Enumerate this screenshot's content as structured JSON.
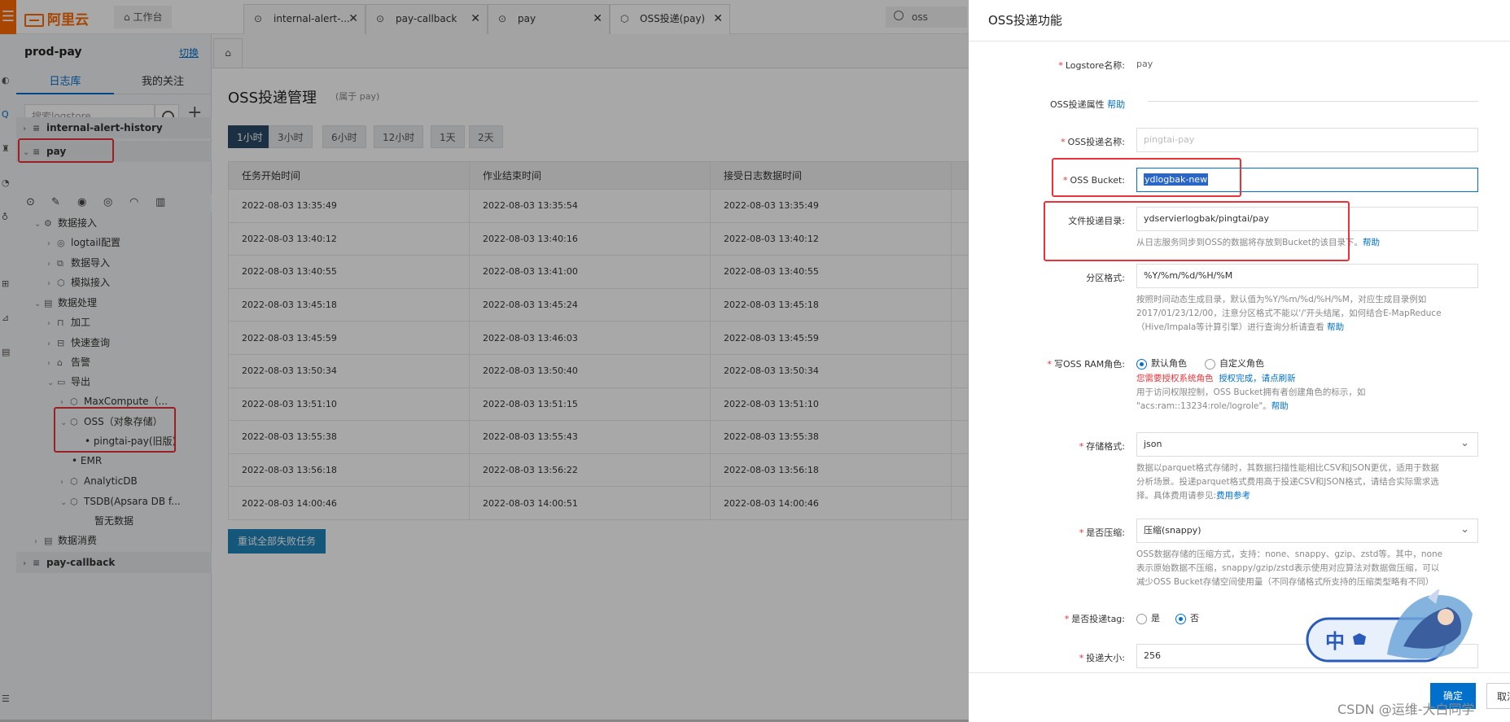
{
  "topbar": {
    "menu_icon": "menu-icon",
    "brand": "阿里云",
    "workbench": "工作台",
    "search_value": "oss"
  },
  "sidebar": {
    "project": "prod-pay",
    "switch_label": "切换",
    "tabs": [
      "日志库",
      "我的关注"
    ],
    "search_placeholder": "搜索logstore",
    "items": [
      {
        "label": "internal-alert-history"
      },
      {
        "label": "pay"
      },
      {
        "label": "数据接入"
      },
      {
        "label": "logtail配置"
      },
      {
        "label": "数据导入"
      },
      {
        "label": "模拟接入"
      },
      {
        "label": "数据处理"
      },
      {
        "label": "加工"
      },
      {
        "label": "快速查询"
      },
      {
        "label": "告警"
      },
      {
        "label": "导出"
      },
      {
        "label": "MaxCompute（..."
      },
      {
        "label": "OSS（对象存储）"
      },
      {
        "label": "pingtai-pay(旧版)"
      },
      {
        "label": "EMR"
      },
      {
        "label": "AnalyticDB"
      },
      {
        "label": "TSDB(Apsara DB f..."
      },
      {
        "label": "暂无数据"
      },
      {
        "label": "数据消费"
      },
      {
        "label": "pay-callback"
      }
    ]
  },
  "tabs": [
    {
      "label": "internal-alert-..."
    },
    {
      "label": "pay-callback"
    },
    {
      "label": "pay"
    },
    {
      "label": "OSS投递(pay)"
    }
  ],
  "main": {
    "title": "OSS投递管理",
    "subtitle": "(属于 pay)",
    "ranges": [
      "1小时",
      "3小时",
      "6小时",
      "12小时",
      "1天",
      "2天"
    ],
    "columns": [
      "任务开始时间",
      "作业结束时间",
      "接受日志数据时间"
    ],
    "rows": [
      [
        "2022-08-03 13:35:49",
        "2022-08-03 13:35:54",
        "2022-08-03 13:35:49"
      ],
      [
        "2022-08-03 13:40:12",
        "2022-08-03 13:40:16",
        "2022-08-03 13:40:12"
      ],
      [
        "2022-08-03 13:40:55",
        "2022-08-03 13:41:00",
        "2022-08-03 13:40:55"
      ],
      [
        "2022-08-03 13:45:18",
        "2022-08-03 13:45:24",
        "2022-08-03 13:45:18"
      ],
      [
        "2022-08-03 13:45:59",
        "2022-08-03 13:46:03",
        "2022-08-03 13:45:59"
      ],
      [
        "2022-08-03 13:50:34",
        "2022-08-03 13:50:40",
        "2022-08-03 13:50:34"
      ],
      [
        "2022-08-03 13:51:10",
        "2022-08-03 13:51:15",
        "2022-08-03 13:51:10"
      ],
      [
        "2022-08-03 13:55:38",
        "2022-08-03 13:55:43",
        "2022-08-03 13:55:38"
      ],
      [
        "2022-08-03 13:56:18",
        "2022-08-03 13:56:22",
        "2022-08-03 13:56:18"
      ],
      [
        "2022-08-03 14:00:46",
        "2022-08-03 14:00:51",
        "2022-08-03 14:00:46"
      ]
    ],
    "retry_label": "重试全部失败任务"
  },
  "drawer": {
    "title": "OSS投递功能",
    "logstore_label": "Logstore名称:",
    "logstore_value": "pay",
    "section_label": "OSS投递属性",
    "help": "帮助",
    "name_label": "OSS投递名称:",
    "name_placeholder": "pingtai-pay",
    "bucket_label": "OSS Bucket:",
    "bucket_value": "ydlogbak-new",
    "dir_label": "文件投递目录:",
    "dir_value": "ydservierlogbak/pingtai/pay",
    "dir_help": "从日志服务同步到OSS的数据将存放到Bucket的该目录下。",
    "partition_label": "分区格式:",
    "partition_value": "%Y/%m/%d/%H/%M",
    "partition_help_1": "按照时间动态生成目录，默认值为%Y/%m/%d/%H/%M，对应生成目录例如",
    "partition_help_2": "2017/01/23/12/00，注意分区格式不能以'/'开头结尾，如何结合E-MapReduce",
    "partition_help_3": "（Hive/Impala等计算引擎）进行查询分析请查看",
    "role_label": "写OSS RAM角色:",
    "role_default": "默认角色",
    "role_custom": "自定义角色",
    "role_warn": "您需要授权系统角色",
    "role_auth_done": "授权完成，请点刷新",
    "role_help_1": "用于访问权限控制，OSS Bucket拥有者创建角色的标示，如",
    "role_help_2": "\"acs:ram::13234:role/logrole\"。",
    "storage_label": "存储格式:",
    "storage_value": "json",
    "storage_help_1": "数据以parquet格式存储时，其数据扫描性能相比CSV和JSON更优，适用于数据",
    "storage_help_2": "分析场景。投递parquet格式费用高于投递CSV和JSON格式，请结合实际需求选",
    "storage_help_3": "择。具体费用请参见:",
    "storage_help_link": "费用参考",
    "compress_label": "是否压缩:",
    "compress_value": "压缩(snappy)",
    "compress_help_1": "OSS数据存储的压缩方式，支持：none、snappy、gzip、zstd等。其中，none",
    "compress_help_2": "表示原始数据不压缩，snappy/gzip/zstd表示使用对应算法对数据做压缩，可以",
    "compress_help_3": "减少OSS Bucket存储空间使用量（不同存储格式所支持的压缩类型略有不同）",
    "tag_label": "是否投递tag:",
    "tag_yes": "是",
    "tag_no": "否",
    "size_label": "投递大小:",
    "size_value": "256",
    "ok": "确定",
    "cancel": "取消"
  },
  "badge": "中",
  "watermark": "CSDN @运维-大白同学"
}
